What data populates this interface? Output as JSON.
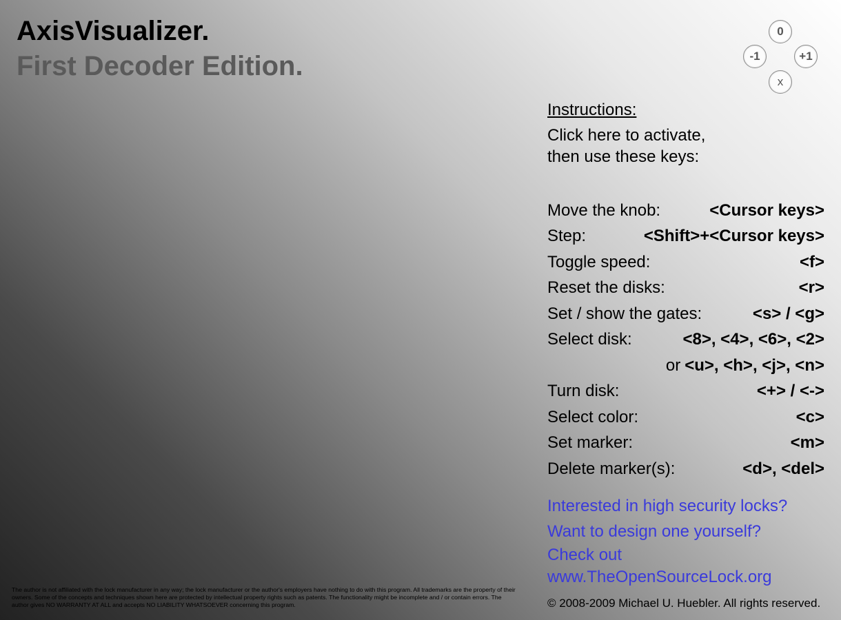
{
  "header": {
    "title": "AxisVisualizer.",
    "subtitle": "First Decoder Edition."
  },
  "knob_buttons": {
    "top": "0",
    "left": "-1",
    "right": "+1",
    "bottom": "x"
  },
  "instructions": {
    "heading": "Instructions:",
    "intro_line1": "Click here to activate,",
    "intro_line2": "then use these keys:",
    "rows": [
      {
        "label": "Move the knob:",
        "keys": "<Cursor keys>"
      },
      {
        "label": "Step:",
        "keys": "<Shift>+<Cursor keys>"
      },
      {
        "label": "Toggle speed:",
        "keys": "<f>"
      },
      {
        "label": "Reset the disks:",
        "keys": "<r>"
      },
      {
        "label": "Set / show the gates:",
        "keys": "<s> / <g>"
      },
      {
        "label": "Select disk:",
        "keys": "<8>, <4>, <6>, <2>"
      },
      {
        "label": "or",
        "keys": "<u>, <h>, <j>, <n>"
      },
      {
        "label": "Turn disk:",
        "keys": "<+> / <->"
      },
      {
        "label": "Select color:",
        "keys": "<c>"
      },
      {
        "label": "Set marker:",
        "keys": "<m>"
      },
      {
        "label": "Delete marker(s):",
        "keys": "<d>, <del>"
      }
    ]
  },
  "links": {
    "line1": "Interested in high security locks?",
    "line2": "Want to design one yourself?",
    "line3": "Check out",
    "url": "www.TheOpenSourceLock.org"
  },
  "copyright": "© 2008-2009 Michael U. Huebler. All rights reserved.",
  "disclaimer": "The author is not affiliated with the lock manufacturer in any way; the lock manufacturer or the author's employers have nothing to do with this program. All trademarks are the property of their owners. Some of the concepts and techniques shown here are protected by intellectual property rights such as patents. The functionality might be incomplete and / or contain errors. The author gives NO WARRANTY AT ALL and accepts NO LIABILITY WHATSOEVER concerning this program."
}
